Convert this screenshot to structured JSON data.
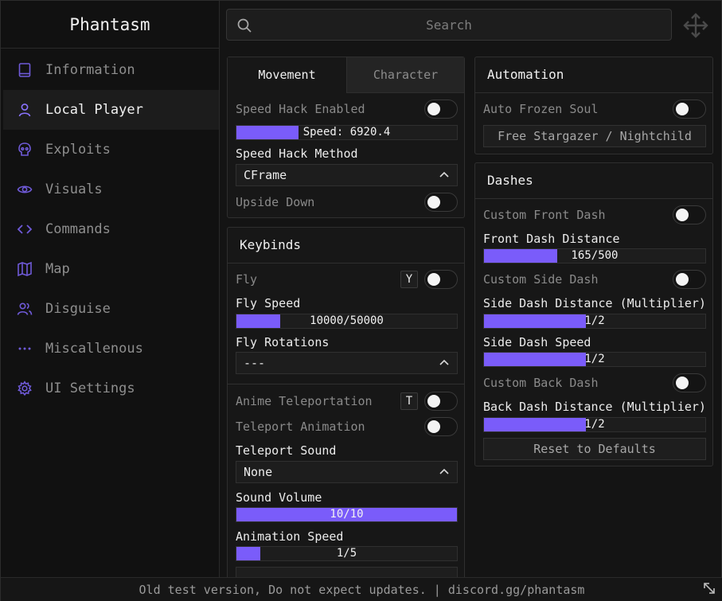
{
  "app": {
    "title": "Phantasm"
  },
  "theme": {
    "accent": "#7a5cfa",
    "background": "#141414",
    "panel": "#171717"
  },
  "search": {
    "placeholder": "Search",
    "icon": "search-icon"
  },
  "sidebar": {
    "items": [
      {
        "label": "Information",
        "icon": "book-icon",
        "active": false
      },
      {
        "label": "Local Player",
        "icon": "user-icon",
        "active": true
      },
      {
        "label": "Exploits",
        "icon": "skull-icon",
        "active": false
      },
      {
        "label": "Visuals",
        "icon": "eye-icon",
        "active": false
      },
      {
        "label": "Commands",
        "icon": "code-icon",
        "active": false
      },
      {
        "label": "Map",
        "icon": "map-icon",
        "active": false
      },
      {
        "label": "Disguise",
        "icon": "users-icon",
        "active": false
      },
      {
        "label": "Miscallenous",
        "icon": "ellipsis-icon",
        "active": false
      },
      {
        "label": "UI Settings",
        "icon": "gear-icon",
        "active": false
      }
    ]
  },
  "movement": {
    "tabs": [
      {
        "label": "Movement",
        "active": true
      },
      {
        "label": "Character",
        "active": false
      }
    ],
    "speed_hack_enabled": {
      "label": "Speed Hack Enabled",
      "on": false
    },
    "speed_slider": {
      "text": "Speed: 6920.4",
      "fill": 0.28
    },
    "speed_hack_method": {
      "label": "Speed Hack Method",
      "value": "CFrame"
    },
    "upside_down": {
      "label": "Upside Down",
      "on": false
    }
  },
  "keybinds": {
    "title": "Keybinds",
    "fly": {
      "label": "Fly",
      "key": "Y",
      "on": false
    },
    "fly_speed": {
      "label": "Fly Speed",
      "text": "10000/50000",
      "fill": 0.2
    },
    "fly_rotations": {
      "label": "Fly Rotations",
      "value": "---"
    },
    "anime_teleportation": {
      "label": "Anime Teleportation",
      "key": "T",
      "on": false
    },
    "teleport_animation": {
      "label": "Teleport Animation",
      "on": false
    },
    "teleport_sound": {
      "label": "Teleport Sound",
      "value": "None"
    },
    "sound_volume": {
      "label": "Sound Volume",
      "text": "10/10",
      "fill": 1.0
    },
    "animation_speed": {
      "label": "Animation Speed",
      "text": "1/5",
      "fill": 0.11
    }
  },
  "automation": {
    "title": "Automation",
    "auto_frozen_soul": {
      "label": "Auto Frozen Soul",
      "on": false
    },
    "free_button": "Free Stargazer / Nightchild"
  },
  "dashes": {
    "title": "Dashes",
    "custom_front_dash": {
      "label": "Custom Front Dash",
      "on": false
    },
    "front_dash_distance": {
      "label": "Front Dash Distance",
      "text": "165/500",
      "fill": 0.33
    },
    "custom_side_dash": {
      "label": "Custom Side Dash",
      "on": false
    },
    "side_dash_distance": {
      "label": "Side Dash Distance (Multiplier)",
      "text": "1/2",
      "fill": 0.46
    },
    "side_dash_speed": {
      "label": "Side Dash Speed",
      "text": "1/2",
      "fill": 0.46
    },
    "custom_back_dash": {
      "label": "Custom Back Dash",
      "on": false
    },
    "back_dash_distance": {
      "label": "Back Dash Distance (Multiplier)",
      "text": "1/2",
      "fill": 0.46
    },
    "reset_button": "Reset to Defaults"
  },
  "footer": {
    "text": "Old test version, Do not expect updates. | discord.gg/phantasm"
  }
}
